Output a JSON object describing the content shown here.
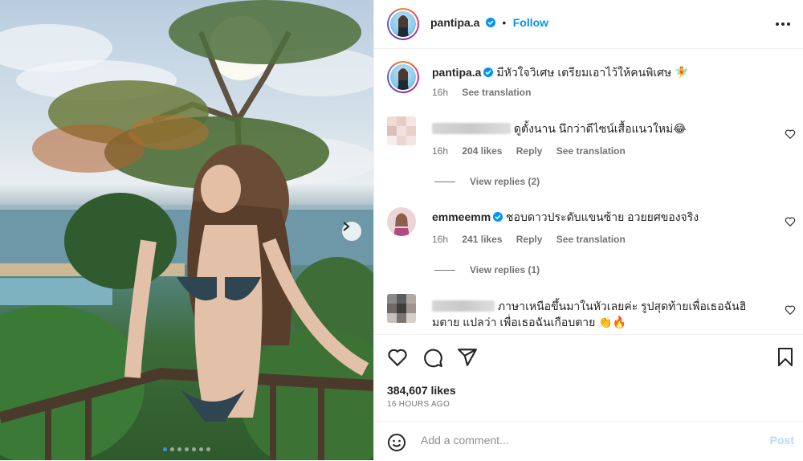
{
  "post": {
    "username": "pantipa.a",
    "follow_label": "Follow",
    "caption": "มีหัวใจวิเศษ เตรียมเอาไว้ให้คนพิเศษ",
    "caption_emoji": "🧚",
    "caption_time": "16h",
    "see_translation": "See translation",
    "likes": "384,607 likes",
    "timestamp": "16 HOURS AGO",
    "carousel": {
      "slides": 7,
      "active": 1
    }
  },
  "comments": [
    {
      "username_hidden": true,
      "text": "ดูตั้งนาน นึกว่าดีไซน์เสื้อแนวใหม่",
      "emoji": "😂",
      "time": "16h",
      "likes": "204 likes",
      "reply": "Reply",
      "see_translation": "See translation",
      "view_replies": "View replies (2)"
    },
    {
      "username": "emmeemm",
      "text": "ชอบดาวประดับแขนซ้าย อวยยศของจริง",
      "time": "16h",
      "likes": "241 likes",
      "reply": "Reply",
      "see_translation": "See translation",
      "view_replies": "View replies (1)"
    },
    {
      "username_hidden": true,
      "text": "ภาษาเหนือขึ้นมาในหัวเลยค่ะ รูปสุดท้ายเพื่อเธอฉันฮิ",
      "text_line2": "มตาย แปลว่า เพื่อเธอฉันเกือบตาย",
      "emoji": "👏🔥"
    }
  ],
  "composer": {
    "placeholder": "Add a comment...",
    "post_label": "Post"
  },
  "colors": {
    "accent": "#0095f6",
    "post_disabled": "#b3dbff",
    "text": "#262626",
    "secondary": "#737373"
  },
  "icons": [
    "verified-badge-icon",
    "more-options-icon",
    "heart-icon",
    "comment-icon",
    "share-icon",
    "bookmark-icon",
    "emoji-icon",
    "chevron-right-icon"
  ]
}
